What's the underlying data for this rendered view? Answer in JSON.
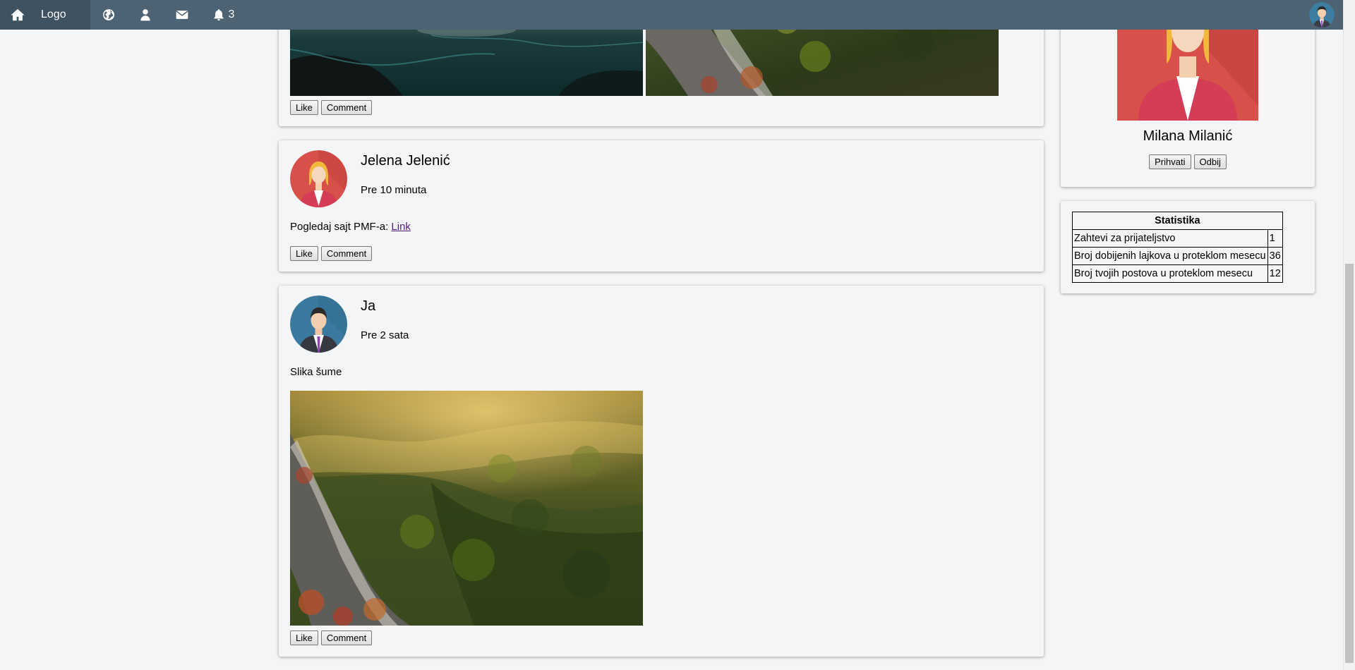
{
  "navbar": {
    "logo": "Logo",
    "notification_count": "3",
    "icons": [
      "home-icon",
      "globe-icon",
      "user-icon",
      "mail-icon",
      "bell-icon"
    ]
  },
  "posts": [
    {
      "buttons": {
        "like": "Like",
        "comment": "Comment"
      }
    },
    {
      "author": "Jelena Jelenić",
      "time": "Pre 10 minuta",
      "text": "Pogledaj sajt PMF-a: ",
      "link": "Link",
      "buttons": {
        "like": "Like",
        "comment": "Comment"
      }
    },
    {
      "author": "Ja",
      "time": "Pre 2 sata",
      "text": "Slika šume",
      "buttons": {
        "like": "Like",
        "comment": "Comment"
      }
    }
  ],
  "friend_request": {
    "name": "Milana Milanić",
    "accept": "Prihvati",
    "reject": "Odbij"
  },
  "stats": {
    "title": "Statistika",
    "rows": [
      {
        "label": "Zahtevi za prijateljstvo",
        "value": "1"
      },
      {
        "label": "Broj dobijenih lajkova u proteklom mesecu",
        "value": "36"
      },
      {
        "label": "Broj tvojih postova u proteklom mesecu",
        "value": "12"
      }
    ]
  },
  "colors": {
    "navbar": "#4d6373",
    "navbar_home": "#3f5261",
    "page_bg": "#f4f5f7",
    "link": "#551a8b"
  }
}
